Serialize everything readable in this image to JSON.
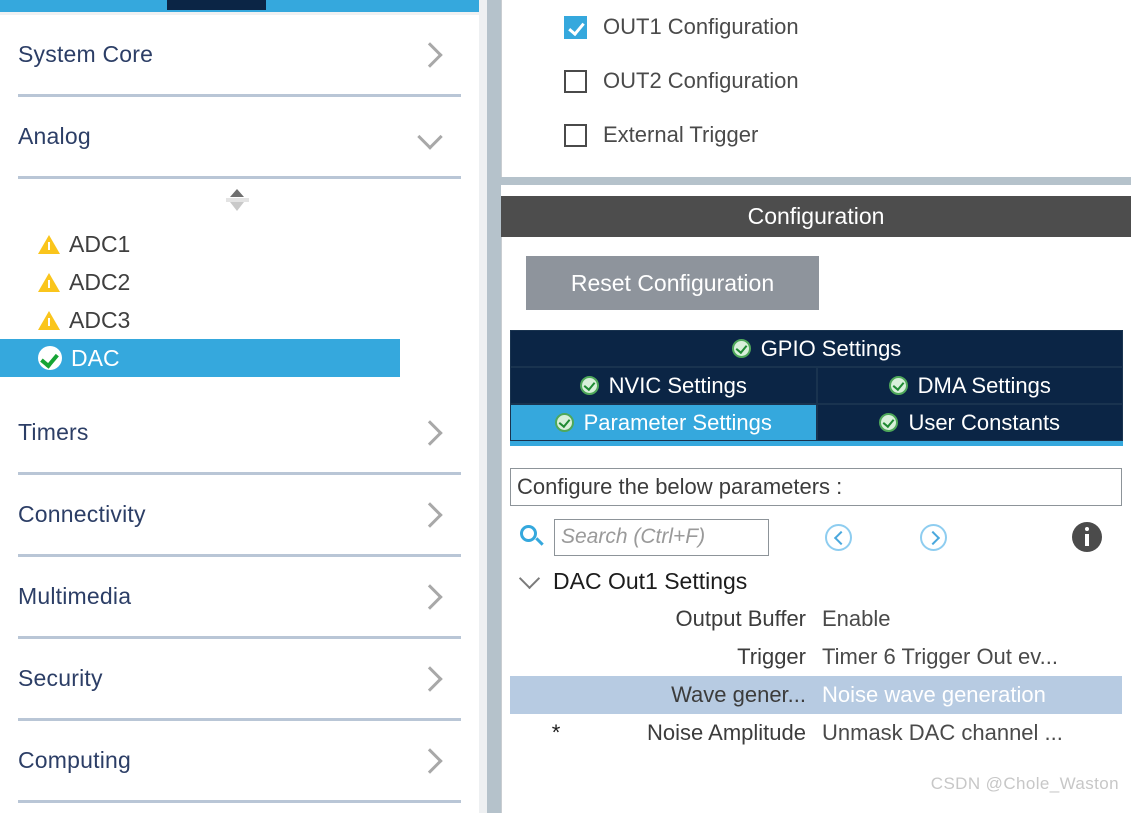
{
  "sidebar": {
    "categories_top": [
      {
        "label": "System Core",
        "chevron": "chevron-right-icon"
      },
      {
        "label": "Analog",
        "chevron": "chevron-down-icon"
      }
    ],
    "peripherals": [
      {
        "label": "ADC1",
        "status": "warning-icon",
        "selected": false
      },
      {
        "label": "ADC2",
        "status": "warning-icon",
        "selected": false
      },
      {
        "label": "ADC3",
        "status": "warning-icon",
        "selected": false
      },
      {
        "label": "DAC",
        "status": "check-ok-icon",
        "selected": true
      }
    ],
    "categories_bottom": [
      {
        "label": "Timers",
        "chevron": "chevron-right-icon"
      },
      {
        "label": "Connectivity",
        "chevron": "chevron-right-icon"
      },
      {
        "label": "Multimedia",
        "chevron": "chevron-right-icon"
      },
      {
        "label": "Security",
        "chevron": "chevron-right-icon"
      },
      {
        "label": "Computing",
        "chevron": "chevron-right-icon"
      }
    ]
  },
  "mode_panel": {
    "checkboxes": [
      {
        "label": "OUT1 Configuration",
        "checked": true
      },
      {
        "label": "OUT2 Configuration",
        "checked": false
      },
      {
        "label": "External Trigger",
        "checked": false
      }
    ]
  },
  "configuration": {
    "title": "Configuration",
    "reset_button": "Reset Configuration",
    "tabs": [
      {
        "label": "GPIO Settings",
        "active": false,
        "width": "full"
      },
      {
        "label": "NVIC Settings",
        "active": false,
        "width": "half"
      },
      {
        "label": "DMA Settings",
        "active": false,
        "width": "half"
      },
      {
        "label": "Parameter Settings",
        "active": true,
        "width": "half"
      },
      {
        "label": "User Constants",
        "active": false,
        "width": "half"
      }
    ],
    "banner": "Configure the below parameters :",
    "search": {
      "placeholder": "Search (Ctrl+F)",
      "value": ""
    },
    "param_group": "DAC Out1 Settings",
    "params": [
      {
        "star": "",
        "name": "Output Buffer",
        "value": "Enable",
        "highlight": false
      },
      {
        "star": "",
        "name": "Trigger",
        "value": "Timer 6 Trigger Out ev...",
        "highlight": false
      },
      {
        "star": "",
        "name": "Wave gener...",
        "value": "Noise wave generation",
        "highlight": true
      },
      {
        "star": "*",
        "name": "Noise Amplitude",
        "value": "Unmask DAC channel ...",
        "highlight": false
      }
    ]
  },
  "watermark": "CSDN @Chole_Waston",
  "colors": {
    "accent_blue": "#35a8dd",
    "navy": "#0b2545",
    "warning_yellow": "#fac51c",
    "ok_green": "#16a435",
    "header_gray": "#4d4d4d",
    "highlight_row": "#b7cbe2"
  }
}
